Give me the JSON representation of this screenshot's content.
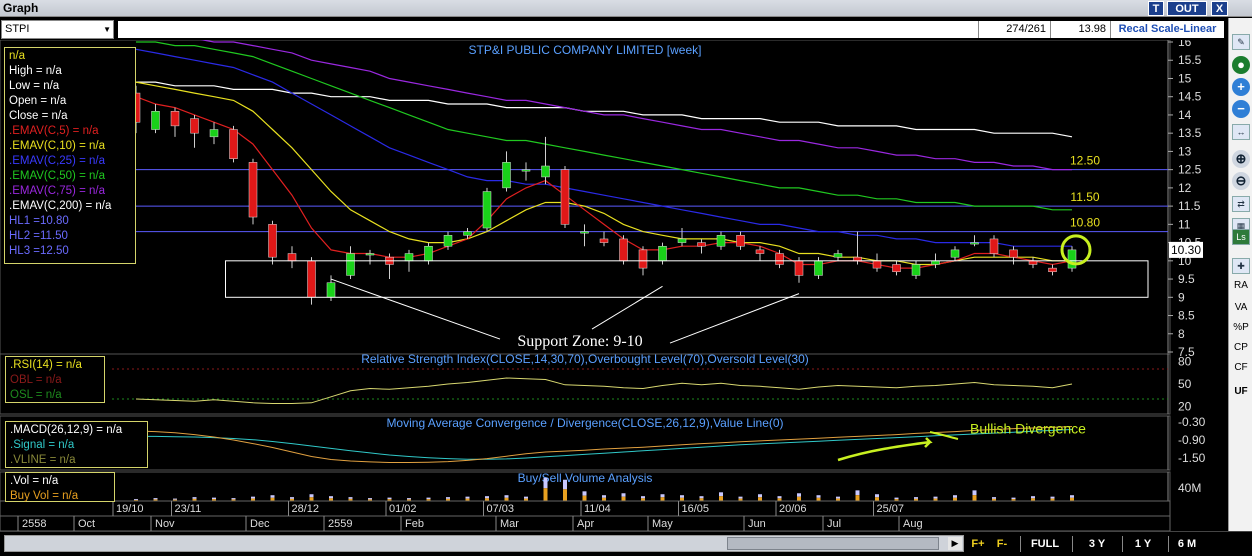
{
  "window": {
    "title": "Graph",
    "btn_t": "T",
    "btn_out": "OUT",
    "btn_close": "X"
  },
  "toolbar": {
    "symbol": "STPI",
    "count": "274/261",
    "last_price": "13.98",
    "scale_label": "Recal Scale-Linear"
  },
  "colors": {
    "background": "#000000",
    "candle_up": "#19d219",
    "candle_down": "#e01818",
    "ema5": "#e02020",
    "ema10": "#e8e020",
    "ema25": "#2a2ae6",
    "ema50": "#20c820",
    "ema75": "#9a28e0",
    "ema200": "#ffffff",
    "hl": "#5b5bff",
    "rsi": "#d8d870",
    "macd": "#e0a040",
    "signal": "#30c8c8",
    "annotation": "#c8f020"
  },
  "legend_price": {
    "name": "n/a",
    "high": "High  = n/a",
    "low": "Low  = n/a",
    "open": "Open  = n/a",
    "close": "Close = n/a",
    "ema5": ".EMAV(C,5)   = n/a",
    "ema10": ".EMAV(C,10)  = n/a",
    "ema25": ".EMAV(C,25)  = n/a",
    "ema50": ".EMAV(C,50)  = n/a",
    "ema75": ".EMAV(C,75)  = n/a",
    "ema200": ".EMAV(C,200)  = n/a",
    "hl1": "HL1 =10.80",
    "hl2": "HL2 =11.50",
    "hl3": "HL3 =12.50"
  },
  "legend_rsi": {
    "rsi": ".RSI(14)  = n/a",
    "obl": "OBL  = n/a",
    "osl": "OSL  = n/a"
  },
  "legend_macd": {
    "macd": ".MACD(26,12,9)  = n/a",
    "signal": ".Signal  = n/a",
    "vline": ".VLINE  = n/a"
  },
  "legend_vol": {
    "vol": ".Vol  = n/a",
    "buyvol": "Buy Vol  = n/a"
  },
  "right_toolbar": {
    "ra": "RA",
    "va": "VA",
    "pct": "%P",
    "cp": "CP",
    "cf": "CF",
    "uf": "UF",
    "ls": "Ls"
  },
  "bottombar": {
    "f_plus": "F+",
    "f_minus": "F-",
    "full": "FULL",
    "three_y": "3 Y",
    "one_y": "1 Y",
    "six_m": "6 M"
  },
  "chart_data": [
    {
      "type": "candlestick",
      "title": "STP&I PUBLIC COMPANY LIMITED [week]",
      "ylim": [
        7.5,
        16
      ],
      "y_ticks": [
        16,
        15.5,
        15,
        14.5,
        14,
        13.5,
        13,
        12.5,
        12,
        11.5,
        11,
        10.5,
        10,
        9.5,
        9,
        8.5,
        8,
        7.5
      ],
      "last_value_label": "10.30",
      "last_value": 10.3,
      "x_labels_top": [
        "19/10",
        "23/11",
        "28/12",
        "01/02",
        "07/03",
        "11/04",
        "16/05",
        "20/06",
        "25/07"
      ],
      "x_labels_bottom": [
        "2558",
        "Oct",
        "Nov",
        "Dec",
        "2559",
        "Feb",
        "Mar",
        "Apr",
        "May",
        "Jun",
        "Jul",
        "Aug"
      ],
      "candles": [
        [
          14.6,
          13.8,
          14.8,
          13.5
        ],
        [
          13.6,
          14.1,
          14.3,
          13.5
        ],
        [
          14.1,
          13.7,
          14.2,
          13.4
        ],
        [
          13.9,
          13.5,
          14.0,
          13.1
        ],
        [
          13.4,
          13.6,
          13.8,
          13.2
        ],
        [
          13.6,
          12.8,
          13.7,
          12.7
        ],
        [
          12.7,
          11.2,
          12.8,
          11.0
        ],
        [
          11.0,
          10.1,
          11.1,
          9.9
        ],
        [
          10.2,
          10.0,
          10.4,
          9.8
        ],
        [
          10.0,
          9.0,
          10.1,
          8.8
        ],
        [
          9.0,
          9.4,
          9.6,
          8.9
        ],
        [
          9.6,
          10.2,
          10.4,
          9.5
        ],
        [
          10.2,
          10.2,
          10.3,
          9.9
        ],
        [
          10.1,
          9.9,
          10.2,
          9.5
        ],
        [
          10.0,
          10.2,
          10.3,
          9.7
        ],
        [
          10.0,
          10.4,
          10.5,
          9.9
        ],
        [
          10.4,
          10.7,
          10.8,
          10.3
        ],
        [
          10.7,
          10.8,
          10.9,
          10.6
        ],
        [
          10.9,
          11.9,
          12.0,
          10.8
        ],
        [
          12.0,
          12.7,
          13.0,
          11.9
        ],
        [
          12.5,
          12.5,
          12.7,
          12.2
        ],
        [
          12.3,
          12.6,
          13.4,
          12.1
        ],
        [
          12.5,
          11.0,
          12.6,
          10.9
        ],
        [
          10.8,
          10.8,
          11.0,
          10.4
        ],
        [
          10.6,
          10.5,
          10.8,
          10.4
        ],
        [
          10.6,
          10.0,
          10.7,
          9.9
        ],
        [
          10.3,
          9.8,
          10.4,
          9.6
        ],
        [
          10.0,
          10.4,
          10.5,
          9.9
        ],
        [
          10.5,
          10.6,
          10.9,
          10.4
        ],
        [
          10.5,
          10.4,
          10.6,
          10.2
        ],
        [
          10.4,
          10.7,
          10.8,
          10.3
        ],
        [
          10.7,
          10.4,
          10.8,
          10.3
        ],
        [
          10.3,
          10.2,
          10.4,
          10.0
        ],
        [
          10.2,
          9.9,
          10.3,
          9.8
        ],
        [
          10.0,
          9.6,
          10.1,
          9.4
        ],
        [
          9.6,
          10.0,
          10.1,
          9.5
        ],
        [
          10.1,
          10.2,
          10.3,
          10.0
        ],
        [
          10.1,
          10.0,
          10.8,
          9.9
        ],
        [
          10.0,
          9.8,
          10.2,
          9.7
        ],
        [
          9.9,
          9.7,
          10.0,
          9.6
        ],
        [
          9.6,
          9.9,
          10.0,
          9.5
        ],
        [
          9.9,
          10.0,
          10.2,
          9.8
        ],
        [
          10.1,
          10.3,
          10.4,
          10.0
        ],
        [
          10.5,
          10.5,
          10.7,
          10.4
        ],
        [
          10.6,
          10.2,
          10.7,
          10.1
        ],
        [
          10.3,
          10.1,
          10.4,
          9.9
        ],
        [
          10.0,
          9.9,
          10.1,
          9.8
        ],
        [
          9.8,
          9.7,
          9.9,
          9.6
        ],
        [
          9.8,
          10.3,
          10.4,
          9.7
        ]
      ],
      "emas": {
        "ema5": [
          14.5,
          14.3,
          14.2,
          14.0,
          13.8,
          13.6,
          13.2,
          12.5,
          11.8,
          10.9,
          10.3,
          10.2,
          10.2,
          10.1,
          10.1,
          10.2,
          10.4,
          10.6,
          11.1,
          11.7,
          12.0,
          12.2,
          11.8,
          11.4,
          11.0,
          10.6,
          10.3,
          10.3,
          10.4,
          10.4,
          10.5,
          10.5,
          10.4,
          10.2,
          9.9,
          9.9,
          10.0,
          10.0,
          9.9,
          9.8,
          9.8,
          9.9,
          10.0,
          10.2,
          10.2,
          10.1,
          10.0,
          9.9,
          10.0
        ],
        "ema10": [
          14.9,
          14.8,
          14.7,
          14.6,
          14.5,
          14.4,
          14.1,
          13.6,
          13.1,
          12.5,
          11.9,
          11.4,
          11.1,
          10.8,
          10.6,
          10.5,
          10.5,
          10.6,
          10.8,
          11.1,
          11.4,
          11.6,
          11.6,
          11.5,
          11.3,
          11.0,
          10.8,
          10.7,
          10.6,
          10.6,
          10.6,
          10.5,
          10.5,
          10.4,
          10.2,
          10.2,
          10.1,
          10.1,
          10.0,
          10.0,
          9.9,
          9.9,
          10.0,
          10.1,
          10.1,
          10.1,
          10.1,
          10.0,
          10.0
        ],
        "ema25": [
          15.8,
          15.7,
          15.6,
          15.5,
          15.4,
          15.3,
          15.1,
          14.9,
          14.6,
          14.3,
          14.0,
          13.7,
          13.4,
          13.1,
          12.9,
          12.7,
          12.5,
          12.3,
          12.2,
          12.2,
          12.1,
          12.1,
          12.0,
          11.9,
          11.8,
          11.7,
          11.6,
          11.5,
          11.4,
          11.3,
          11.2,
          11.1,
          11.0,
          11.0,
          10.9,
          10.8,
          10.8,
          10.7,
          10.7,
          10.6,
          10.6,
          10.5,
          10.5,
          10.5,
          10.5,
          10.4,
          10.4,
          10.4,
          10.4
        ],
        "ema50": [
          16.0,
          16.0,
          15.9,
          15.9,
          15.8,
          15.7,
          15.6,
          15.4,
          15.2,
          15.0,
          14.8,
          14.6,
          14.4,
          14.2,
          14.0,
          13.8,
          13.6,
          13.5,
          13.4,
          13.3,
          13.3,
          13.2,
          13.1,
          13.0,
          12.9,
          12.8,
          12.7,
          12.6,
          12.5,
          12.4,
          12.3,
          12.2,
          12.1,
          12.0,
          12.0,
          11.9,
          11.8,
          11.8,
          11.7,
          11.7,
          11.6,
          11.6,
          11.6,
          11.5,
          11.5,
          11.5,
          11.5,
          11.4,
          11.4
        ],
        "ema75": [
          16.2,
          16.2,
          16.1,
          16.1,
          16.0,
          16.0,
          15.9,
          15.8,
          15.7,
          15.5,
          15.4,
          15.3,
          15.2,
          15.0,
          14.9,
          14.8,
          14.7,
          14.6,
          14.5,
          14.4,
          14.4,
          14.3,
          14.2,
          14.1,
          14.0,
          14.0,
          13.9,
          13.8,
          13.7,
          13.6,
          13.6,
          13.5,
          13.4,
          13.3,
          13.3,
          13.2,
          13.1,
          13.1,
          13.0,
          12.9,
          12.9,
          12.8,
          12.8,
          12.7,
          12.7,
          12.6,
          12.6,
          12.5,
          12.5
        ],
        "ema200": [
          14.9,
          14.9,
          14.8,
          14.8,
          14.8,
          14.7,
          14.7,
          14.7,
          14.6,
          14.6,
          14.5,
          14.5,
          14.5,
          14.4,
          14.4,
          14.4,
          14.3,
          14.3,
          14.3,
          14.2,
          14.2,
          14.2,
          14.2,
          14.1,
          14.1,
          14.1,
          14.0,
          14.0,
          14.0,
          13.9,
          13.9,
          13.9,
          13.9,
          13.8,
          13.8,
          13.8,
          13.7,
          13.7,
          13.7,
          13.7,
          13.6,
          13.6,
          13.6,
          13.6,
          13.5,
          13.5,
          13.5,
          13.5,
          13.4
        ]
      },
      "horizontal_levels": [
        {
          "value": 12.5,
          "label": "12.50"
        },
        {
          "value": 11.5,
          "label": "11.50"
        },
        {
          "value": 10.8,
          "label": "10.80"
        }
      ],
      "support_zone": {
        "y_range": [
          9,
          10
        ],
        "x_range_candles": [
          5,
          48
        ],
        "label": "Support Zone: 9-10"
      }
    },
    {
      "type": "line",
      "title": "Relative Strength Index(CLOSE,14,30,70),Overbought Level(70),Oversold Level(30)",
      "ylim": [
        10,
        90
      ],
      "y_ticks": [
        80,
        50,
        20
      ],
      "levels": [
        70,
        30
      ],
      "values": [
        30,
        29,
        28,
        27,
        29,
        27,
        25,
        24,
        24,
        25,
        33,
        41,
        44,
        43,
        45,
        47,
        50,
        52,
        55,
        58,
        57,
        56,
        49,
        48,
        47,
        45,
        44,
        48,
        51,
        49,
        51,
        48,
        47,
        45,
        43,
        46,
        48,
        47,
        46,
        45,
        47,
        48,
        50,
        52,
        49,
        48,
        47,
        45,
        50
      ]
    },
    {
      "type": "line",
      "title": "Moving Average Convergence / Divergence(CLOSE,26,12,9),Value Line(0)",
      "ylim": [
        -1.9,
        -0.1
      ],
      "y_ticks": [
        -0.3,
        -0.9,
        -1.5
      ],
      "macd": [
        -0.6,
        -0.62,
        -0.66,
        -0.72,
        -0.8,
        -0.9,
        -1.02,
        -1.15,
        -1.3,
        -1.45,
        -1.55,
        -1.6,
        -1.63,
        -1.65,
        -1.65,
        -1.64,
        -1.62,
        -1.58,
        -1.52,
        -1.44,
        -1.36,
        -1.3,
        -1.27,
        -1.24,
        -1.2,
        -1.17,
        -1.14,
        -1.1,
        -1.06,
        -1.02,
        -0.99,
        -0.96,
        -0.93,
        -0.9,
        -0.87,
        -0.84,
        -0.81,
        -0.78,
        -0.75,
        -0.72,
        -0.68,
        -0.65,
        -0.62,
        -0.58,
        -0.55,
        -0.52,
        -0.5,
        -0.48,
        -0.45
      ],
      "signal": [
        -0.78,
        -0.78,
        -0.79,
        -0.8,
        -0.82,
        -0.85,
        -0.89,
        -0.95,
        -1.02,
        -1.1,
        -1.18,
        -1.26,
        -1.33,
        -1.4,
        -1.45,
        -1.49,
        -1.52,
        -1.54,
        -1.54,
        -1.53,
        -1.5,
        -1.46,
        -1.42,
        -1.38,
        -1.34,
        -1.3,
        -1.26,
        -1.22,
        -1.18,
        -1.14,
        -1.1,
        -1.06,
        -1.03,
        -1.0,
        -0.97,
        -0.94,
        -0.91,
        -0.88,
        -0.85,
        -0.82,
        -0.79,
        -0.76,
        -0.73,
        -0.7,
        -0.67,
        -0.64,
        -0.61,
        -0.58,
        -0.55
      ],
      "annotation": "Bullish Divergence"
    },
    {
      "type": "bar",
      "title": "Buy/Sell Volume Analysis",
      "y_ticks": [
        "40M"
      ],
      "ylim": [
        0,
        60
      ],
      "values": [
        4,
        6,
        5,
        8,
        7,
        6,
        9,
        12,
        8,
        14,
        10,
        8,
        6,
        7,
        6,
        7,
        8,
        9,
        10,
        12,
        9,
        48,
        44,
        20,
        12,
        16,
        10,
        14,
        12,
        10,
        18,
        9,
        14,
        10,
        16,
        12,
        9,
        22,
        14,
        7,
        8,
        9,
        12,
        22,
        8,
        7,
        10,
        9,
        12
      ],
      "buy_fraction": 0.55
    }
  ]
}
